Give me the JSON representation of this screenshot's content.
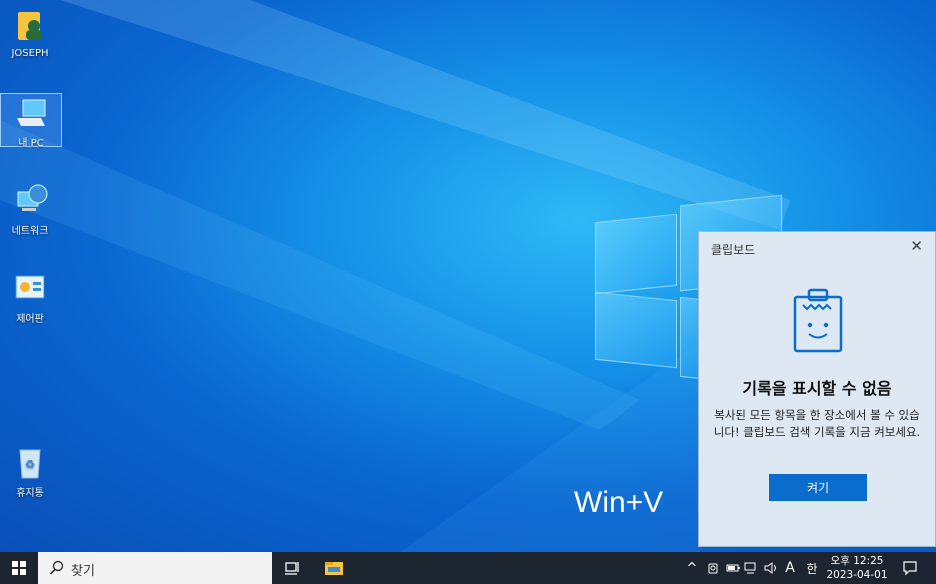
{
  "desktop": {
    "icons": [
      {
        "label": "JOSEPH",
        "icon": "user-folder-icon"
      },
      {
        "label": "내 PC",
        "icon": "this-pc-icon"
      },
      {
        "label": "네트워크",
        "icon": "network-icon"
      },
      {
        "label": "제어판",
        "icon": "control-panel-icon"
      },
      {
        "label": "휴지통",
        "icon": "recycle-bin-icon"
      }
    ],
    "overlay_text": "Win+V"
  },
  "clipboard": {
    "title": "클립보드",
    "close": "✕",
    "heading": "기록을 표시할 수 없음",
    "description": "복사된 모든 항목을 한 장소에서 볼 수 있습니다! 클립보드 검색 기록을 지금 켜보세요.",
    "button_label": "켜기",
    "accent": "#0a6ccc"
  },
  "taskbar": {
    "search_placeholder": "찾기",
    "tray": {
      "chevron": "^",
      "ime": "A",
      "ime_mode": "한"
    },
    "clock": {
      "time": "오후 12:25",
      "date": "2023-04-01"
    }
  },
  "colors": {
    "taskbar": "#1c2530",
    "desktop": "#1592e8"
  }
}
